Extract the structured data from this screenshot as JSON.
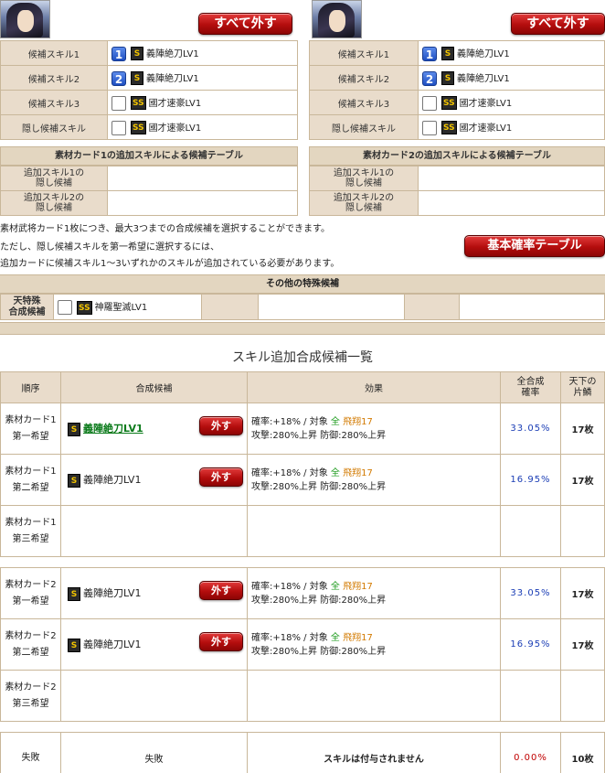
{
  "cards": [
    {
      "remove_all": "すべて外す",
      "rows": [
        {
          "label": "候補スキル1",
          "badge": "1",
          "rank": "S",
          "skill": "義陣絶刀LV1"
        },
        {
          "label": "候補スキル2",
          "badge": "2",
          "rank": "S",
          "skill": "義陣絶刀LV1"
        },
        {
          "label": "候補スキル3",
          "badge": "",
          "rank": "SS",
          "skill": "國才速豪LV1"
        },
        {
          "label": "隠し候補スキル",
          "badge": "",
          "rank": "SS",
          "skill": "國才速豪LV1"
        }
      ],
      "add_title": "素材カード1の追加スキルによる候補テーブル",
      "add_rows": [
        {
          "label1": "追加スキル1の",
          "label2": "隠し候補"
        },
        {
          "label1": "追加スキル2の",
          "label2": "隠し候補"
        }
      ]
    },
    {
      "remove_all": "すべて外す",
      "rows": [
        {
          "label": "候補スキル1",
          "badge": "1",
          "rank": "S",
          "skill": "義陣絶刀LV1"
        },
        {
          "label": "候補スキル2",
          "badge": "2",
          "rank": "S",
          "skill": "義陣絶刀LV1"
        },
        {
          "label": "候補スキル3",
          "badge": "",
          "rank": "SS",
          "skill": "國才速豪LV1"
        },
        {
          "label": "隠し候補スキル",
          "badge": "",
          "rank": "SS",
          "skill": "國才速豪LV1"
        }
      ],
      "add_title": "素材カード2の追加スキルによる候補テーブル",
      "add_rows": [
        {
          "label1": "追加スキル1の",
          "label2": "隠し候補"
        },
        {
          "label1": "追加スキル2の",
          "label2": "隠し候補"
        }
      ]
    }
  ],
  "notes": [
    "素材武将カード1枚につき、最大3つまでの合成候補を選択することができます。",
    "ただし、隠し候補スキルを第一希望に選択するには、",
    "追加カードに候補スキル1〜3いずれかのスキルが追加されている必要があります。"
  ],
  "base_prob_button": "基本確率テーブル",
  "special": {
    "title": "その他の特殊候補",
    "label1": "天特殊",
    "label2": "合成候補",
    "rank": "SS",
    "skill": "神羅聖滅LV1"
  },
  "list": {
    "title": "スキル追加合成候補一覧",
    "headers": {
      "order": "順序",
      "candidate": "合成候補",
      "effect": "効果",
      "rate1": "全合成",
      "rate2": "確率",
      "tenka1": "天下の",
      "tenka2": "片鱗"
    },
    "remove_label": "外す",
    "rows": [
      {
        "card": "素材カード1",
        "pref": "第一希望",
        "rank": "S",
        "skill": "義陣絶刀LV1",
        "linked": true,
        "eff_a": "確率:+18% / 対象",
        "eff_all": "全",
        "eff_unit": "飛翔17",
        "eff_b": "攻撃:280%上昇 防御:280%上昇",
        "rate": "33.05%",
        "tenka": "17枚"
      },
      {
        "card": "素材カード1",
        "pref": "第二希望",
        "rank": "S",
        "skill": "義陣絶刀LV1",
        "linked": false,
        "eff_a": "確率:+18% / 対象",
        "eff_all": "全",
        "eff_unit": "飛翔17",
        "eff_b": "攻撃:280%上昇 防御:280%上昇",
        "rate": "16.95%",
        "tenka": "17枚"
      },
      {
        "card": "素材カード1",
        "pref": "第三希望",
        "empty": true
      },
      {
        "card": "素材カード2",
        "pref": "第一希望",
        "rank": "S",
        "skill": "義陣絶刀LV1",
        "linked": false,
        "eff_a": "確率:+18% / 対象",
        "eff_all": "全",
        "eff_unit": "飛翔17",
        "eff_b": "攻撃:280%上昇 防御:280%上昇",
        "rate": "33.05%",
        "tenka": "17枚"
      },
      {
        "card": "素材カード2",
        "pref": "第二希望",
        "rank": "S",
        "skill": "義陣絶刀LV1",
        "linked": false,
        "eff_a": "確率:+18% / 対象",
        "eff_all": "全",
        "eff_unit": "飛翔17",
        "eff_b": "攻撃:280%上昇 防御:280%上昇",
        "rate": "16.95%",
        "tenka": "17枚"
      },
      {
        "card": "素材カード2",
        "pref": "第三希望",
        "empty": true
      }
    ],
    "fail": {
      "order": "失敗",
      "candidate": "失敗",
      "effect": "スキルは付与されません",
      "rate": "0.00%",
      "tenka": "10枚"
    }
  },
  "colors": {
    "accent_red": "#b40d0d",
    "rate_blue": "#1a3db5",
    "fail_red": "#c00000",
    "label_bg": "#e9dccb"
  }
}
